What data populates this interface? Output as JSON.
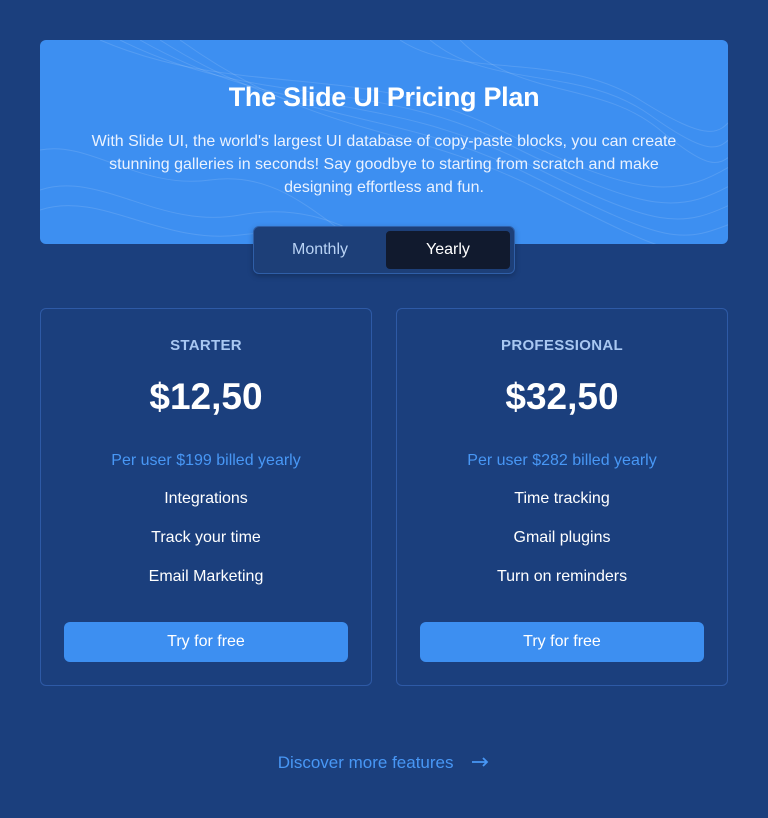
{
  "hero": {
    "title": "The Slide UI Pricing Plan",
    "description": "With Slide UI, the world's largest UI database of copy-paste blocks, you can create stunning galleries in seconds! Say goodbye to starting from scratch and make designing effortless and fun."
  },
  "billing_toggle": {
    "options": [
      "Monthly",
      "Yearly"
    ],
    "selected": "Yearly"
  },
  "plans": [
    {
      "name": "STARTER",
      "price": "$12,50",
      "billing": "Per user $199 billed yearly",
      "features": [
        "Integrations",
        "Track your time",
        "Email Marketing"
      ],
      "cta": "Try for free"
    },
    {
      "name": "PROFESSIONAL",
      "price": "$32,50",
      "billing": "Per user $282 billed yearly",
      "features": [
        "Time tracking",
        "Gmail plugins",
        "Turn on reminders"
      ],
      "cta": "Try for free"
    }
  ],
  "footer_link": {
    "label": "Discover more features",
    "icon": "arrow-right-icon"
  },
  "colors": {
    "background": "#1b3f7d",
    "accent": "#3d8ff1",
    "link": "#4897f5",
    "selected_toggle": "#111a2e"
  }
}
